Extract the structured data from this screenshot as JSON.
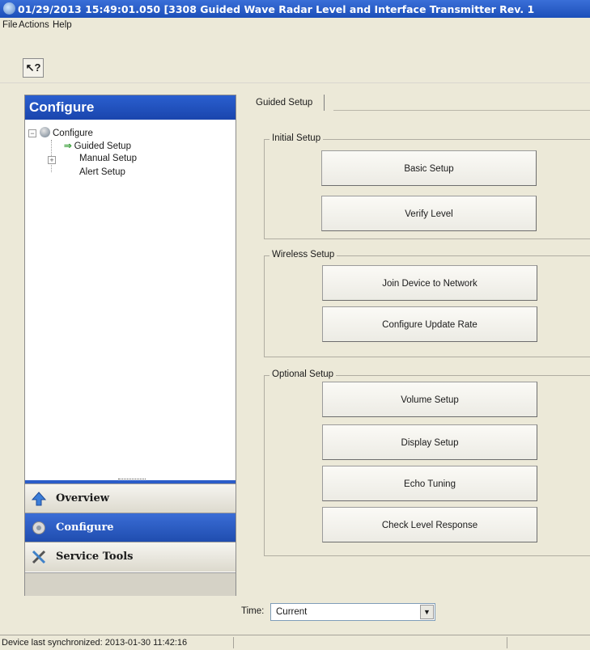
{
  "window": {
    "title": "01/29/2013 15:49:01.050 [3308 Guided Wave Radar Level and Interface Transmitter Rev. 1"
  },
  "menu": {
    "items": [
      "File",
      "Actions",
      "Help"
    ]
  },
  "toolbar": {
    "help_button": "↖?"
  },
  "left_pane": {
    "header": "Configure",
    "tree": {
      "root": "Configure",
      "children": [
        "Guided Setup",
        "Manual Setup",
        "Alert Setup"
      ],
      "selected": "Guided Setup"
    },
    "nav": [
      {
        "label": "Overview",
        "icon": "up-arrow-icon",
        "active": false
      },
      {
        "label": "Configure",
        "icon": "gear-globe-icon",
        "active": true
      },
      {
        "label": "Service Tools",
        "icon": "tools-icon",
        "active": false
      }
    ]
  },
  "tabs": {
    "active": "Guided Setup"
  },
  "groups": [
    {
      "label": "Initial Setup",
      "buttons": [
        "Basic Setup",
        "Verify Level"
      ]
    },
    {
      "label": "Wireless Setup",
      "buttons": [
        "Join Device to Network",
        "Configure Update Rate"
      ]
    },
    {
      "label": "Optional Setup",
      "buttons": [
        "Volume Setup",
        "Display Setup",
        "Echo Tuning",
        "Check Level Response"
      ]
    }
  ],
  "time": {
    "label": "Time:",
    "value": "Current"
  },
  "status": {
    "text": "Device last synchronized: 2013-01-30 11:42:16"
  },
  "colors": {
    "title_bar": "#1c4fb9",
    "pane_header": "#1a45ad",
    "active_nav": "#1f4cae",
    "tree_arrow": "#3ea23e"
  }
}
